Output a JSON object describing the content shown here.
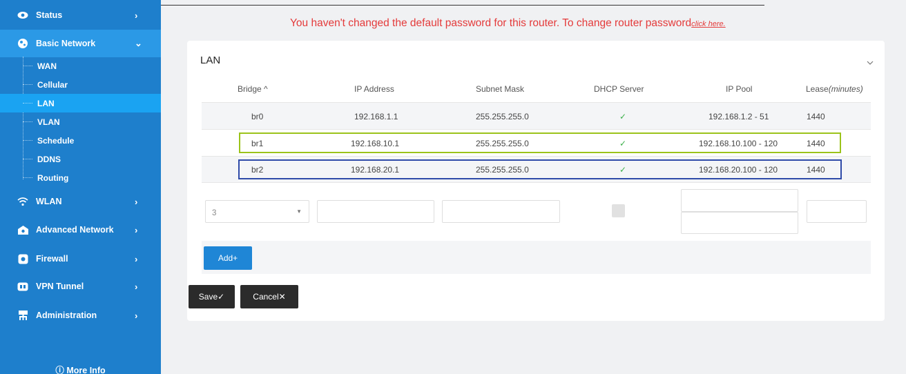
{
  "sidebar": {
    "items": [
      {
        "label": "Status",
        "icon": "eye-icon",
        "chevron": "›"
      },
      {
        "label": "Basic Network",
        "icon": "globe-icon",
        "chevron": "⌄"
      },
      {
        "label": "WLAN",
        "icon": "wifi-icon",
        "chevron": "›"
      },
      {
        "label": "Advanced Network",
        "icon": "network-icon",
        "chevron": "›"
      },
      {
        "label": "Firewall",
        "icon": "firewall-icon",
        "chevron": "›"
      },
      {
        "label": "VPN Tunnel",
        "icon": "vpn-icon",
        "chevron": "›"
      },
      {
        "label": "Administration",
        "icon": "admin-icon",
        "chevron": "›"
      }
    ],
    "sub_items": [
      "WAN",
      "Cellular",
      "LAN",
      "VLAN",
      "Schedule",
      "DDNS",
      "Routing"
    ],
    "active_sub": "LAN",
    "more_info": "More Info"
  },
  "warning": {
    "text": "You haven't changed the default password for this router. To change router password",
    "link": "click here."
  },
  "card": {
    "title": "LAN",
    "headers": {
      "bridge": "Bridge ^",
      "ip": "IP Address",
      "mask": "Subnet Mask",
      "dhcp": "DHCP Server",
      "pool": "IP Pool",
      "lease": "Lease",
      "lease_unit": "(minutes)"
    },
    "rows": [
      {
        "bridge": "br0",
        "ip": "192.168.1.1",
        "mask": "255.255.255.0",
        "dhcp": "✓",
        "pool": "192.168.1.2 - 51",
        "lease": "1440"
      },
      {
        "bridge": "br1",
        "ip": "192.168.10.1",
        "mask": "255.255.255.0",
        "dhcp": "✓",
        "pool": "192.168.10.100 - 120",
        "lease": "1440"
      },
      {
        "bridge": "br2",
        "ip": "192.168.20.1",
        "mask": "255.255.255.0",
        "dhcp": "✓",
        "pool": "192.168.20.100 - 120",
        "lease": "1440"
      }
    ],
    "new_row": {
      "bridge_select": "3"
    },
    "add_label": "Add+",
    "save_label": "Save✓",
    "cancel_label": "Cancel✕"
  },
  "colors": {
    "sidebar": "#1e7fcc",
    "active_sub": "#1aa3f2",
    "warning": "#e43a3a",
    "highlight_green": "#9bc31a",
    "highlight_blue": "#2e4aa8",
    "add_button": "#1f86d6"
  }
}
